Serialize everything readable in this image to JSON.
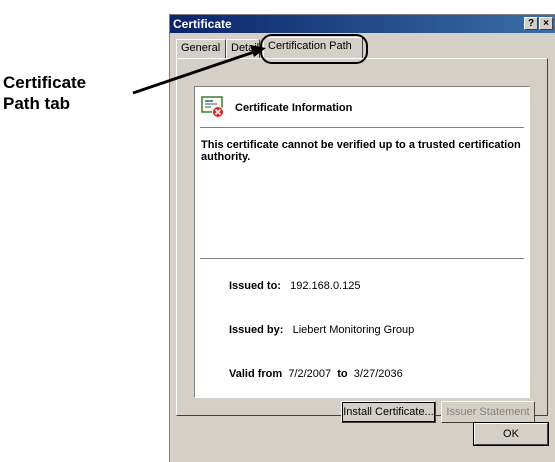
{
  "callout": {
    "line1": "Certificate",
    "line2": "Path tab"
  },
  "window": {
    "title": "Certificate",
    "help_glyph": "?",
    "close_glyph": "×"
  },
  "tabs": [
    {
      "label": "General"
    },
    {
      "label": "Details"
    },
    {
      "label": "Certification Path"
    }
  ],
  "info": {
    "icon": "certificate-error-icon",
    "header": "Certificate Information",
    "warning": "This certificate cannot be verified up to a trusted certification authority.",
    "issued_to_label": "Issued to:",
    "issued_to": "192.168.0.125",
    "issued_by_label": "Issued by:",
    "issued_by": "Liebert Monitoring Group",
    "valid_from_label": "Valid from",
    "valid_from": "7/2/2007",
    "valid_to_label": "to",
    "valid_to": "3/27/2036"
  },
  "buttons": {
    "install": "Install Certificate...",
    "issuer": "Issuer Statement",
    "ok": "OK"
  }
}
